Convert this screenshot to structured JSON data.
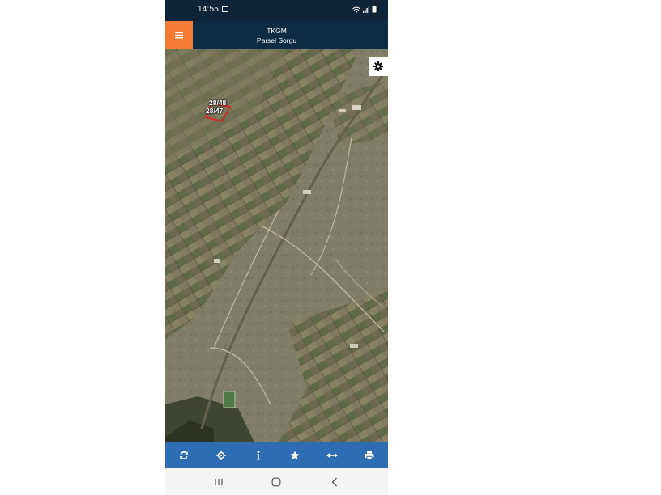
{
  "status_bar": {
    "time": "14:55",
    "icons": [
      "image-icon",
      "wifi-icon",
      "signal-icon",
      "battery-icon"
    ]
  },
  "header": {
    "title": "TKGM",
    "subtitle": "Parsel Sorgu",
    "menu_icon": "hamburger-menu-icon"
  },
  "map": {
    "parcel_labels": [
      "28/48",
      "28/47"
    ],
    "settings_icon": "gear-icon"
  },
  "toolbar": {
    "buttons": [
      "refresh-icon",
      "locate-icon",
      "info-icon",
      "star-icon",
      "measure-icon",
      "print-icon"
    ]
  },
  "navigation": {
    "buttons": [
      "recent-apps-icon",
      "home-icon",
      "back-icon"
    ]
  },
  "colors": {
    "status_bar": "#0e2438",
    "header": "#0e2b44",
    "menu_button": "#f47b34",
    "toolbar": "#2e6db3",
    "parcel_outline": "#d42c2c"
  }
}
